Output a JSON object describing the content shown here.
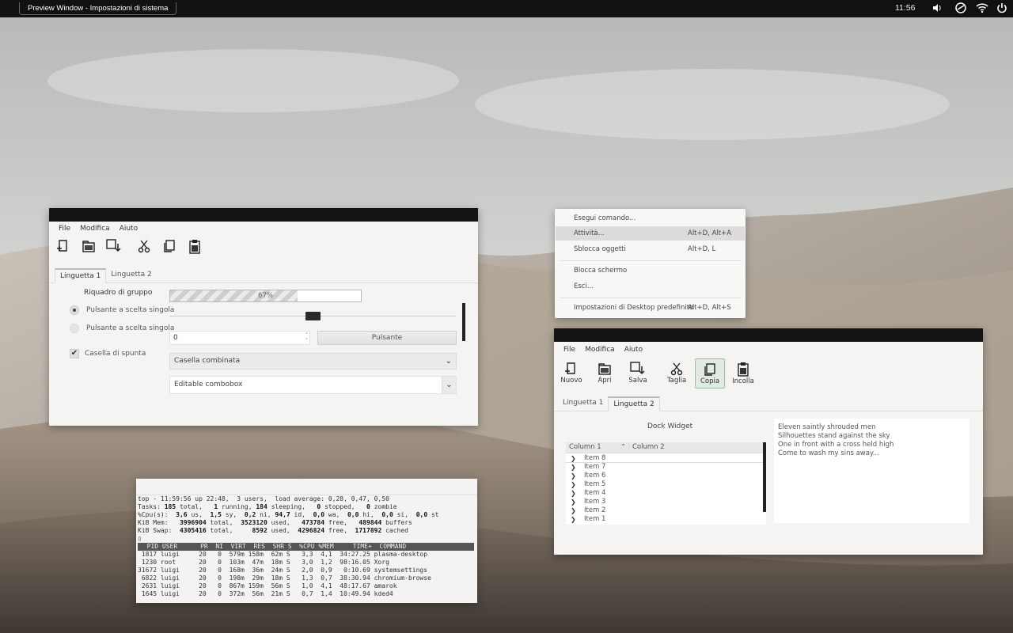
{
  "topbar": {
    "window_title": "Preview Window - Impostazioni di sistema",
    "clock": "11:56",
    "icons": [
      "volume-icon",
      "network-manager-icon",
      "wifi-icon",
      "power-icon"
    ]
  },
  "colors": {
    "titlebar": "#141414",
    "window_bg": "#f5f4f2",
    "topbar": "#111111"
  },
  "win1": {
    "menu": [
      "File",
      "Modifica",
      "Aiuto"
    ],
    "toolbar_icons": [
      "new-document-icon",
      "open-folder-icon",
      "save-icon",
      "cut-icon",
      "copy-icon",
      "paste-icon"
    ],
    "tabs": [
      "Linguetta 1",
      "Linguetta 2"
    ],
    "group_title": "Riquadro di gruppo",
    "radio1": "Pulsante a scelta singola",
    "radio2": "Pulsante a scelta singola",
    "checkbox": "Casella di spunta",
    "progress_text": "67%",
    "progress_value": 67,
    "slider_value": 0.5,
    "spin_value": "0",
    "button": "Pulsante",
    "combo": "Casella combinata",
    "editable_combo": "Editable combobox"
  },
  "popup": {
    "items": [
      {
        "label": "Esegui comando...",
        "shortcut": ""
      },
      {
        "label": "Attività...",
        "shortcut": "Alt+D, Alt+A"
      },
      {
        "label": "Sblocca oggetti",
        "shortcut": "Alt+D, L"
      },
      {
        "label": "Blocca schermo",
        "shortcut": ""
      },
      {
        "label": "Esci...",
        "shortcut": ""
      },
      {
        "label": "Impostazioni di Desktop predefinito",
        "shortcut": "Alt+D, Alt+S"
      }
    ]
  },
  "win2": {
    "menu": [
      "File",
      "Modifica",
      "Aiuto"
    ],
    "toolbar": [
      "Nuovo",
      "Apri",
      "Salva",
      "Taglia",
      "Copia",
      "Incolla"
    ],
    "tabs": [
      "Linguetta 1",
      "Linguetta 2"
    ],
    "dock_title": "Dock Widget",
    "columns": [
      "Column 1",
      "Column 2"
    ],
    "items": [
      "Item 8",
      "Item 7",
      "Item 6",
      "Item 5",
      "Item 4",
      "Item 3",
      "Item 2",
      "Item 1"
    ],
    "text_lines": [
      "Eleven saintly shrouded men",
      "Silhouettes stand against the sky",
      "One in front with a cross held high",
      "Come to wash my sins away..."
    ]
  },
  "terminal": {
    "line1": "top - 11:59:56 up 22:48,  3 users,  load average: 0,28, 0,47, 0,50",
    "tasks_label": "Tasks: ",
    "tasks_total": "185",
    "tasks_t": " total,   ",
    "tasks_running": "1",
    "tasks_r": " running, ",
    "tasks_sleeping": "184",
    "tasks_s": " sleeping,   ",
    "tasks_stopped": "0",
    "tasks_st": " stopped,   ",
    "tasks_zombie": "0",
    "tasks_z": " zombie",
    "cpu_label": "%Cpu(s):  ",
    "cpu_us": "3,6",
    "cpu_us_l": " us,  ",
    "cpu_sy": "1,5",
    "cpu_sy_l": " sy,  ",
    "cpu_ni": "0,2",
    "cpu_ni_l": " ni, ",
    "cpu_id": "94,7",
    "cpu_id_l": " id,  ",
    "cpu_wa": "0,0",
    "cpu_wa_l": " wa,  ",
    "cpu_hi": "0,0",
    "cpu_hi_l": " hi,  ",
    "cpu_si": "0,0",
    "cpu_si_l": " si,  ",
    "cpu_st": "0,0",
    "cpu_st_l": " st",
    "mem_label": "KiB Mem:   ",
    "mem_total": "3996904",
    "mem_t": " total,  ",
    "mem_used": "3523120",
    "mem_u": " used,   ",
    "mem_free": "473784",
    "mem_f": " free,   ",
    "mem_buffers": "489844",
    "mem_b": " buffers",
    "swap_label": "KiB Swap:  ",
    "swap_total": "4305416",
    "swap_t": " total,     ",
    "swap_used": "8592",
    "swap_u": " used,  ",
    "swap_free": "4296824",
    "swap_f": " free,  ",
    "swap_cached": "1717892",
    "swap_c": " cached",
    "cursor": "▯",
    "header": "  PID USER      PR  NI  VIRT  RES  SHR S  %CPU %MEM     TIME+  COMMAND",
    "rows": [
      " 1817 luigi     20   0  579m 158m  62m S   3,3  4,1  34:27.25 plasma-desktop",
      " 1230 root      20   0  103m  47m  18m S   3,0  1,2  98:16.05 Xorg",
      "31672 luigi     20   0  168m  36m  24m S   2,0  0,9   0:10.69 systemsettings",
      " 6822 luigi     20   0  198m  29m  18m S   1,3  0,7  38:30.94 chromium-browse",
      " 2631 luigi     20   0  867m 159m  56m S   1,0  4,1  48:17.67 amarok",
      " 1645 luigi     20   0  372m  56m  21m S   0,7  1,4  10:49.94 kded4"
    ]
  }
}
